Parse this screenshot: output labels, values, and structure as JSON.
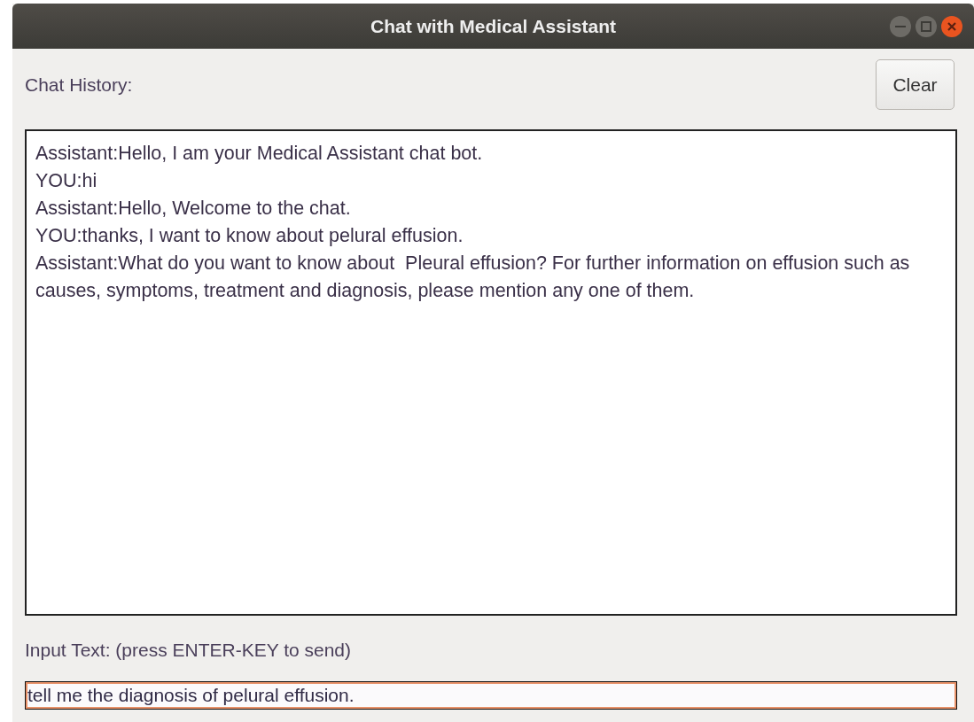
{
  "window": {
    "title": "Chat with Medical Assistant"
  },
  "chat_history": {
    "label": "Chat History:",
    "messages": [
      {
        "text": "Assistant:Hello, I am your Medical Assistant chat bot."
      },
      {
        "text": "YOU:hi"
      },
      {
        "text": "Assistant:Hello, Welcome to the chat."
      },
      {
        "text": "YOU:thanks, I want to know about pelural effusion."
      },
      {
        "text": "Assistant:What do you want to know about  Pleural effusion? For further information on effusion such as causes, symptoms, treatment and diagnosis, please mention any one of them."
      }
    ]
  },
  "clear_button": "Clear",
  "input": {
    "label": "Input Text:  (press ENTER-KEY to send)",
    "value": "tell me the diagnosis of pelural effusion.",
    "focused": true
  }
}
